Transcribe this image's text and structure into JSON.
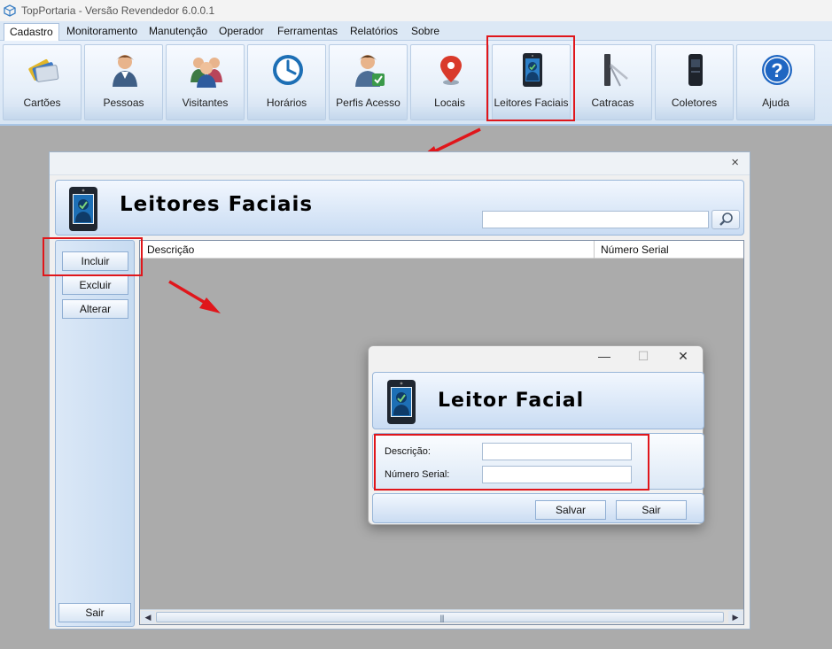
{
  "window": {
    "title": "TopPortaria - Versão Revendedor 6.0.0.1"
  },
  "menu": {
    "tabs": [
      "Cadastro",
      "Monitoramento",
      "Manutenção",
      "Operador",
      "Ferramentas",
      "Relatórios",
      "Sobre"
    ],
    "active": "Cadastro"
  },
  "ribbon": {
    "buttons": [
      {
        "label": "Cartões",
        "icon": "cards-icon"
      },
      {
        "label": "Pessoas",
        "icon": "person-icon"
      },
      {
        "label": "Visitantes",
        "icon": "visitors-icon"
      },
      {
        "label": "Horários",
        "icon": "clock-icon"
      },
      {
        "label": "Perfis Acesso",
        "icon": "access-profile-icon"
      },
      {
        "label": "Locais",
        "icon": "location-pin-icon"
      },
      {
        "label": "Leitores Faciais",
        "icon": "face-reader-icon"
      },
      {
        "label": "Catracas",
        "icon": "turnstile-icon"
      },
      {
        "label": "Coletores",
        "icon": "collector-device-icon"
      },
      {
        "label": "Ajuda",
        "icon": "help-icon"
      }
    ]
  },
  "main_window": {
    "close": "×",
    "header_title": "Leitores Faciais",
    "search": {
      "value": ""
    },
    "side_buttons": {
      "include": "Incluir",
      "delete": "Excluir",
      "edit": "Alterar",
      "exit": "Sair"
    },
    "grid": {
      "columns": [
        "Descrição",
        "Número Serial"
      ],
      "rows": []
    }
  },
  "dialog": {
    "controls": {
      "minimize": "—",
      "maximize": "☐",
      "close": "✕"
    },
    "header_title": "Leitor Facial",
    "fields": {
      "description": {
        "label": "Descrição:",
        "value": ""
      },
      "serial": {
        "label": "Número Serial:",
        "value": ""
      }
    },
    "buttons": {
      "save": "Salvar",
      "exit": "Sair"
    }
  },
  "colors": {
    "highlight": "#e0161b",
    "accent": "#c9dcf3"
  }
}
